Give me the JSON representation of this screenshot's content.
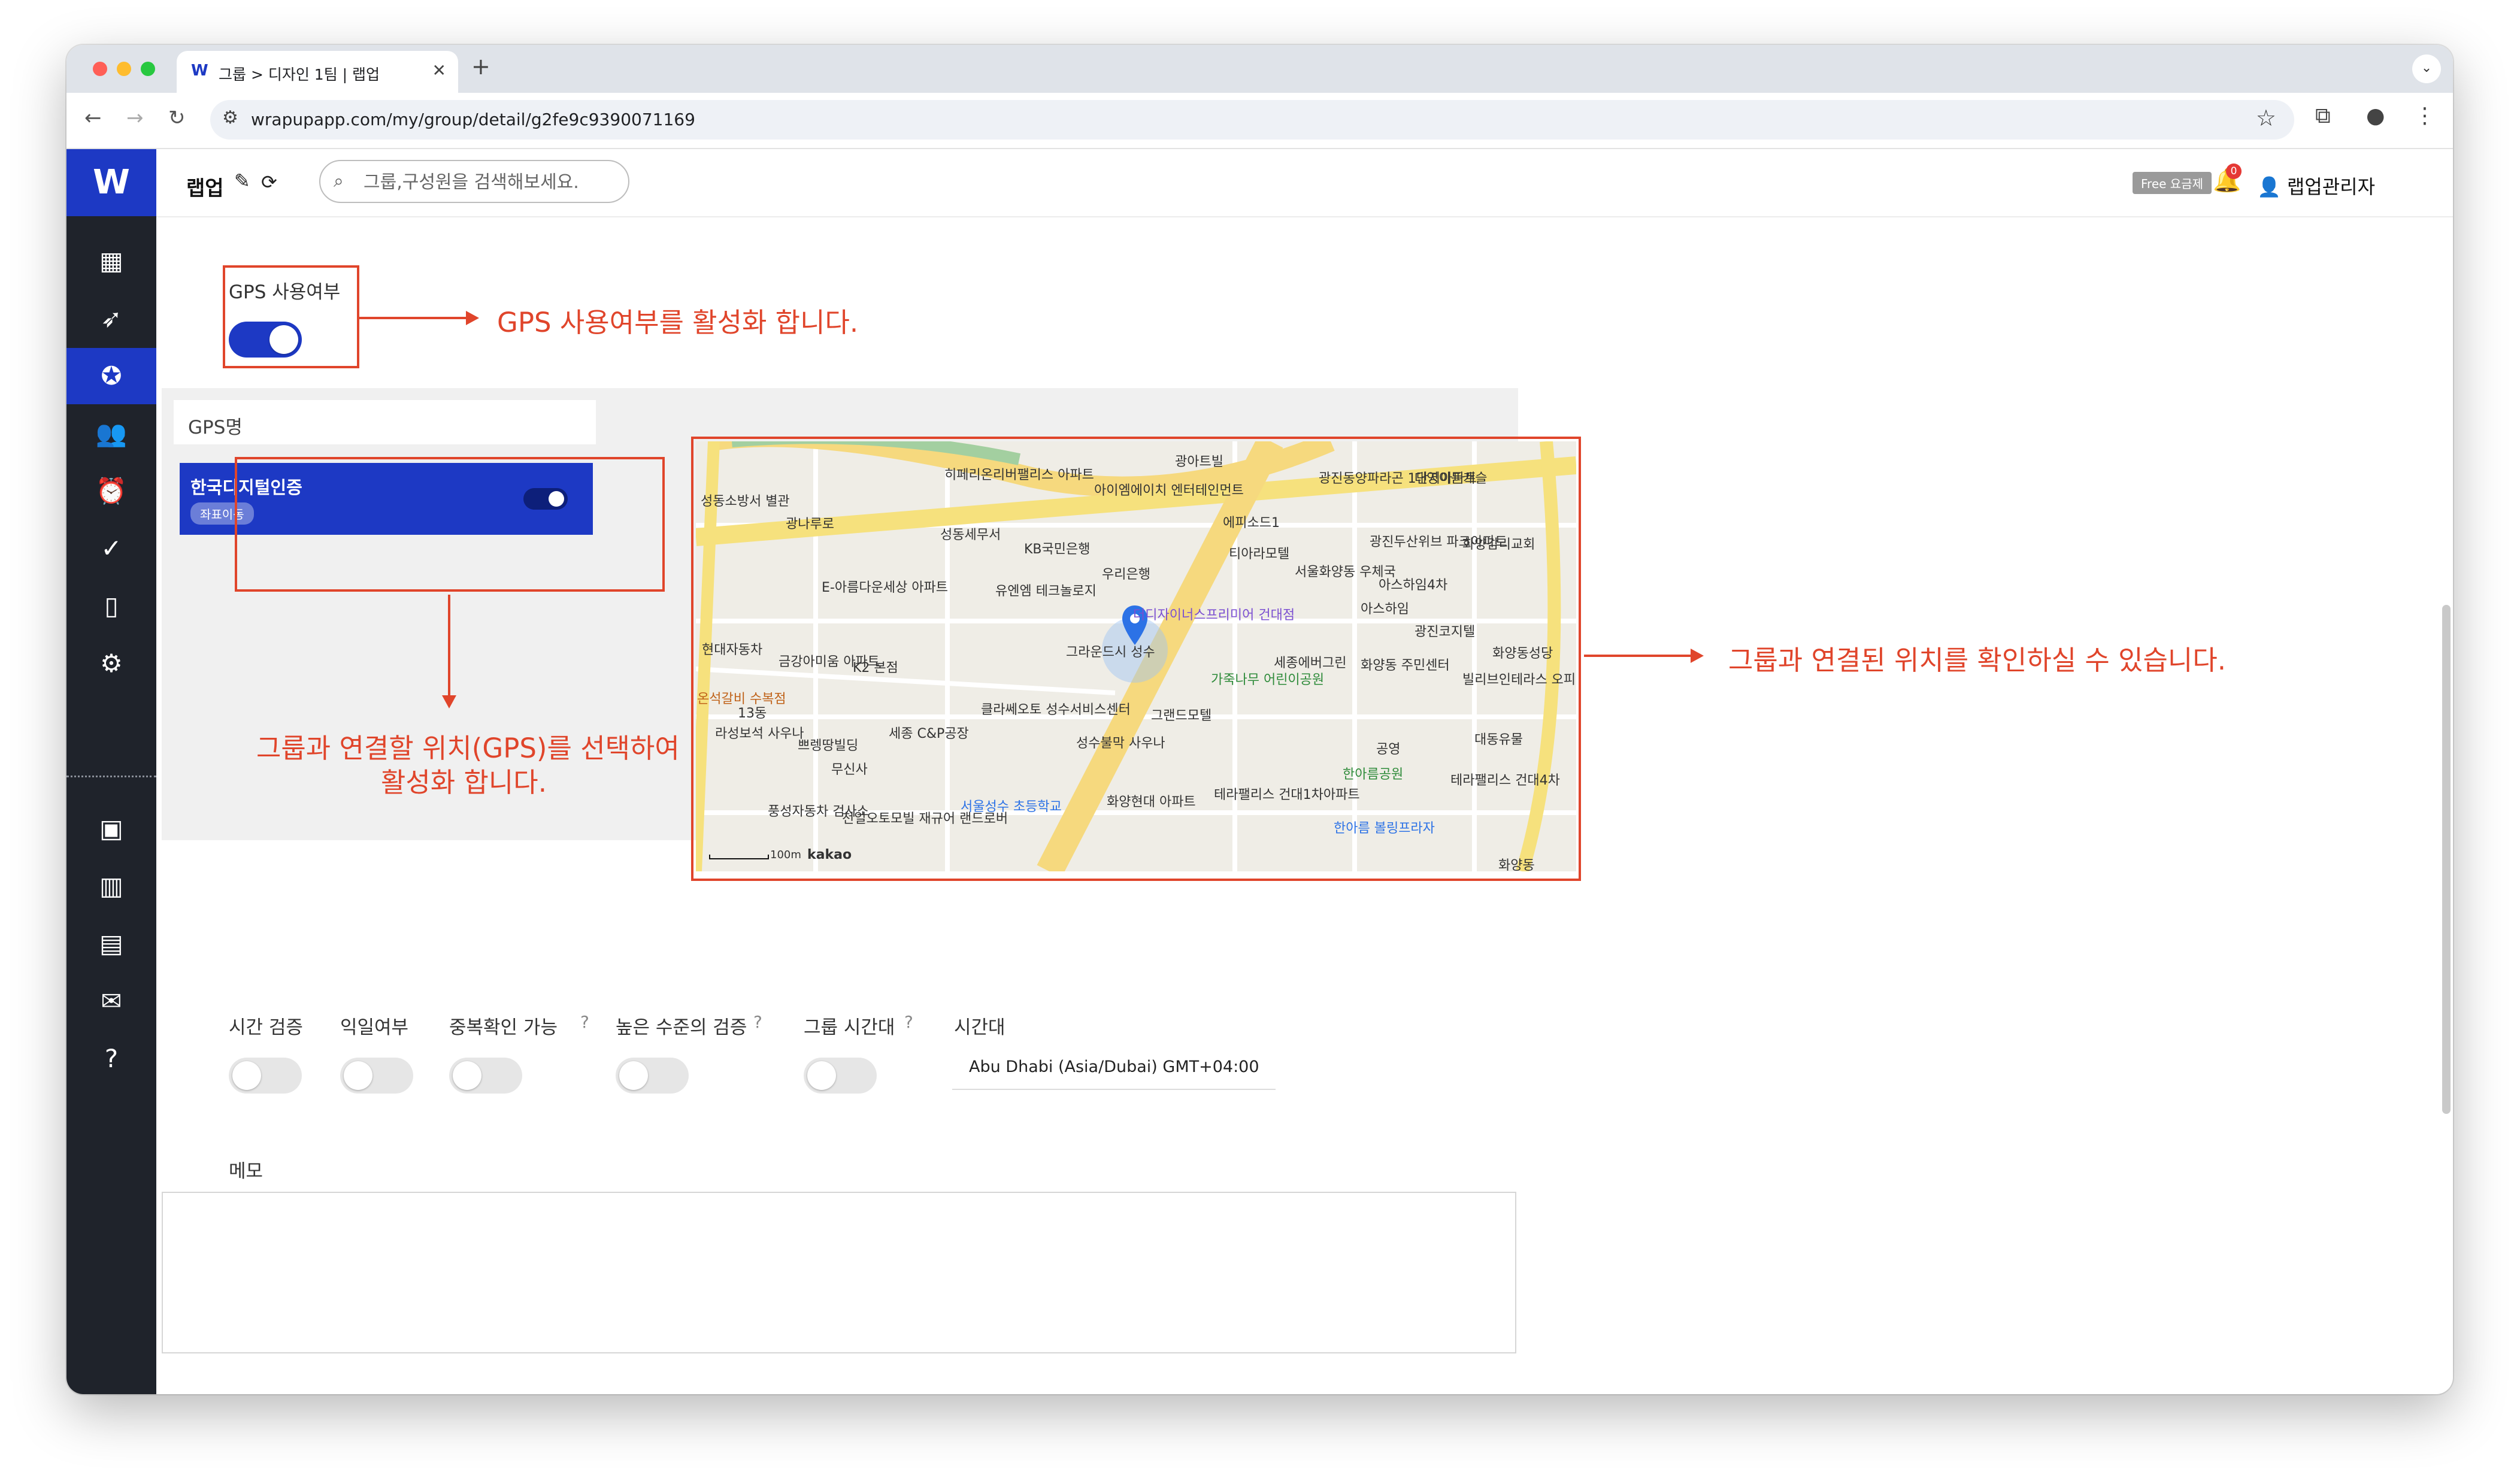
{
  "browser": {
    "tab_title": "그룹 > 디자인 1팀 | 랩업",
    "tab_favicon": "W",
    "url": "wrapupapp.com/my/group/detail/g2fe9c9390071169"
  },
  "app": {
    "logo": "W",
    "name": "랩업",
    "search_placeholder": "그룹,구성원을 검색해보세요.",
    "plan_badge": "Free 요금제",
    "notification_count": "0",
    "user_name": "랩업관리자"
  },
  "sidebar": {
    "items": [
      {
        "icon": "dashboard-icon"
      },
      {
        "icon": "rocket-icon"
      },
      {
        "icon": "group-icon",
        "active": true
      },
      {
        "icon": "people-icon"
      },
      {
        "icon": "alarm-icon"
      },
      {
        "icon": "check-icon"
      },
      {
        "icon": "mobile-icon"
      },
      {
        "icon": "gear-icon"
      },
      {
        "icon": "contact-card-icon"
      },
      {
        "icon": "building-icon"
      },
      {
        "icon": "store-icon"
      },
      {
        "icon": "chat-icon"
      },
      {
        "icon": "help-bubble-icon"
      }
    ]
  },
  "gps": {
    "usage_label": "GPS 사용여부",
    "usage_enabled": true,
    "name_header": "GPS명",
    "location_name": "한국디지털인증",
    "coord_chip": "좌표이동",
    "location_enabled": true
  },
  "annotations": {
    "enable_gps": "GPS 사용여부를 활성화 합니다.",
    "select_location_line1": "그룹과 연결할 위치(GPS)를 선택하여",
    "select_location_line2": "활성화 합니다.",
    "map_hint": "그룹과 연결된 위치를 확인하실 수 있습니다.",
    "color": "#e0452b"
  },
  "map": {
    "scale": "100m",
    "provider": "kakao",
    "labels": [
      "히페리온리버팰리스 아파트",
      "아이엠에이치 엔터테인먼트",
      "광아트빌",
      "광진동양파라곤 1단지아파트",
      "대영이든캐슬",
      "성동소방서 별관",
      "광나루로",
      "성동세무서",
      "KB국민은행",
      "에피소드1",
      "광진두산위브 파크아파트",
      "화양감리교회",
      "E-아름다운세상 아파트",
      "우리은행",
      "티아라모텔",
      "서울화양동 우체국",
      "아스하임4차",
      "유엔엠 테크놀로지",
      "더디자이너스프리미어 건대점",
      "아스하임",
      "광진코지텔",
      "현대자동차",
      "금강아미움 아파트",
      "K2 본점",
      "그라운드시 성수",
      "세종에버그린",
      "가죽나무 어린이공원",
      "화양동 주민센터",
      "빌리브인테라스 오피스텔",
      "화양동성당",
      "온석갈비 수복점",
      "13동",
      "라성보석 사우나",
      "쁘렝땅빌딩",
      "세종 C&P공장",
      "클라쎄오토 성수서비스센터",
      "그랜드모텔",
      "공영",
      "대동유물",
      "성수불막 사우나",
      "무신사",
      "한아름공원",
      "테라팰리스 건대4차",
      "풍성자동차 검사소",
      "천일오토모빌 재규어 랜드로버",
      "서울성수 초등학교",
      "화양현대 아파트",
      "테라팰리스 건대1차아파트",
      "한아름 볼링프라자",
      "화양동"
    ]
  },
  "settings": {
    "time_verify": "시간 검증",
    "anonymous": "익일여부",
    "duplicate_check": "중복확인 가능",
    "high_level_verify": "높은 수준의 검증",
    "group_timezone": "그룹 시간대",
    "timezone_label": "시간대",
    "timezone_value": "Abu Dhabi (Asia/Dubai) GMT+04:00",
    "toggles": [
      false,
      false,
      false,
      false,
      false
    ]
  },
  "memo": {
    "label": "메모",
    "value": ""
  }
}
